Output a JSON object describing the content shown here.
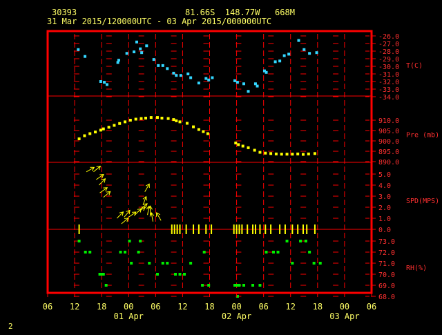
{
  "header": {
    "station": "30393",
    "location": "81.66S  148.77W   668M",
    "period": "31 Mar 2015/120000UTC - 03 Apr 2015/000000UTC"
  },
  "page_number": "2",
  "colors": {
    "background": "#000000",
    "frame": "#ff0000",
    "header_text": "#ffff66",
    "axis_text": "#ff3030",
    "time_labels": "#ffff66",
    "temperature": "#33d6ff",
    "pressure": "#ffff00",
    "wind": "#ffff00",
    "humidity": "#00ee00"
  },
  "chart_data": {
    "type": "scatter",
    "x_unit": "hours since 31 Mar 2015 06 UTC",
    "x_range": [
      0,
      72
    ],
    "x_ticks": [
      "06",
      "12",
      "18",
      "00",
      "06",
      "12",
      "18",
      "00",
      "06",
      "12",
      "18",
      "00",
      "06"
    ],
    "day_labels": [
      {
        "text": "01 Apr",
        "x": 18
      },
      {
        "text": "02 Apr",
        "x": 42
      },
      {
        "text": "03 Apr",
        "x": 66
      }
    ],
    "panels": [
      {
        "id": "temperature",
        "label": "T(C)",
        "ylim": [
          -34,
          -26
        ],
        "ticks": [
          "-26.0",
          "-27.0",
          "-28.0",
          "-29.0",
          "-30.0",
          "-31.0",
          "-32.0",
          "-33.0",
          "-34.0"
        ],
        "points": [
          [
            6.8,
            -27.8
          ],
          [
            8.3,
            -28.7
          ],
          [
            11.8,
            -32.0
          ],
          [
            12.6,
            -32.1
          ],
          [
            13.2,
            -32.4
          ],
          [
            15.6,
            -29.5
          ],
          [
            15.8,
            -29.2
          ],
          [
            17.6,
            -28.3
          ],
          [
            19.2,
            -28.1
          ],
          [
            19.8,
            -26.8
          ],
          [
            20.6,
            -27.7
          ],
          [
            20.9,
            -28.2
          ],
          [
            22.0,
            -27.3
          ],
          [
            23.6,
            -29.1
          ],
          [
            24.6,
            -29.9
          ],
          [
            25.6,
            -29.9
          ],
          [
            26.6,
            -30.3
          ],
          [
            28.0,
            -30.9
          ],
          [
            28.6,
            -31.2
          ],
          [
            29.6,
            -31.2
          ],
          [
            31.2,
            -31.0
          ],
          [
            31.8,
            -31.5
          ],
          [
            33.6,
            -32.2
          ],
          [
            35.2,
            -31.6
          ],
          [
            35.8,
            -31.8
          ],
          [
            36.6,
            -31.5
          ],
          [
            41.6,
            -31.9
          ],
          [
            42.2,
            -32.1
          ],
          [
            43.6,
            -32.3
          ],
          [
            44.6,
            -33.3
          ],
          [
            46.2,
            -32.3
          ],
          [
            46.6,
            -32.6
          ],
          [
            48.2,
            -30.6
          ],
          [
            48.6,
            -30.8
          ],
          [
            50.6,
            -29.4
          ],
          [
            51.6,
            -29.3
          ],
          [
            52.6,
            -28.6
          ],
          [
            53.6,
            -28.4
          ],
          [
            55.8,
            -26.6
          ],
          [
            57.0,
            -27.8
          ],
          [
            58.2,
            -28.3
          ],
          [
            59.8,
            -28.2
          ]
        ]
      },
      {
        "id": "pressure",
        "label": "Pre (mb)",
        "ylim": [
          890,
          915
        ],
        "ticks": [
          "910.0",
          "905.0",
          "900.0",
          "895.0",
          "890.0"
        ],
        "points": [
          [
            7.0,
            901.0
          ],
          [
            8.2,
            902.5
          ],
          [
            9.4,
            903.5
          ],
          [
            10.6,
            904.3
          ],
          [
            11.8,
            905.2
          ],
          [
            12.4,
            905.8
          ],
          [
            13.6,
            906.6
          ],
          [
            14.8,
            907.5
          ],
          [
            16.0,
            908.4
          ],
          [
            17.2,
            909.2
          ],
          [
            18.4,
            910.0
          ],
          [
            19.6,
            910.5
          ],
          [
            20.8,
            910.8
          ],
          [
            21.8,
            911.0
          ],
          [
            23.0,
            911.3
          ],
          [
            24.4,
            911.3
          ],
          [
            25.4,
            911.0
          ],
          [
            26.8,
            910.8
          ],
          [
            28.0,
            910.3
          ],
          [
            28.6,
            909.7
          ],
          [
            29.4,
            909.2
          ],
          [
            31.0,
            908.5
          ],
          [
            32.4,
            906.8
          ],
          [
            33.6,
            905.5
          ],
          [
            34.6,
            904.5
          ],
          [
            35.6,
            903.5
          ],
          [
            41.8,
            899.0
          ],
          [
            42.4,
            898.2
          ],
          [
            43.4,
            897.5
          ],
          [
            44.6,
            896.7
          ],
          [
            46.0,
            895.5
          ],
          [
            47.2,
            894.5
          ],
          [
            48.4,
            894.1
          ],
          [
            49.6,
            893.9
          ],
          [
            50.8,
            893.7
          ],
          [
            52.0,
            893.6
          ],
          [
            53.2,
            893.6
          ],
          [
            54.4,
            893.6
          ],
          [
            55.6,
            893.7
          ],
          [
            56.8,
            893.5
          ],
          [
            58.0,
            893.7
          ],
          [
            59.4,
            893.9
          ]
        ]
      },
      {
        "id": "wind",
        "label": "SPD(MPS)",
        "ylim": [
          0,
          5
        ],
        "ticks": [
          "5.0",
          "4.0",
          "3.0",
          "2.0",
          "1.0",
          "0.0"
        ],
        "arrows": [
          [
            8.6,
            5.2,
            30
          ],
          [
            10.2,
            5.2,
            40
          ],
          [
            10.8,
            4.5,
            35
          ],
          [
            11.4,
            4.0,
            45
          ],
          [
            11.6,
            3.3,
            35
          ],
          [
            12.4,
            2.9,
            40
          ],
          [
            15.4,
            1.0,
            45
          ],
          [
            16.4,
            0.5,
            40
          ],
          [
            17.0,
            1.1,
            50
          ],
          [
            18.0,
            1.1,
            35
          ],
          [
            19.4,
            1.3,
            45
          ],
          [
            20.0,
            1.6,
            30
          ],
          [
            20.6,
            1.8,
            40
          ],
          [
            21.2,
            2.2,
            70
          ],
          [
            21.6,
            3.4,
            60
          ],
          [
            22.2,
            1.3,
            80
          ],
          [
            22.8,
            1.3,
            90
          ],
          [
            23.4,
            0.7,
            100
          ],
          [
            25.2,
            0.8,
            120
          ]
        ],
        "calm_ticks": [
          7.0,
          27.6,
          28.2,
          28.8,
          29.4,
          30.8,
          32.4,
          33.6,
          35.2,
          36.4,
          41.4,
          42.0,
          42.6,
          43.2,
          44.4,
          45.6,
          46.2,
          47.2,
          48.4,
          49.6,
          51.6,
          52.8,
          54.4,
          55.6,
          56.8,
          57.6,
          59.4
        ]
      },
      {
        "id": "humidity",
        "label": "RH(%)",
        "ylim": [
          68,
          73
        ],
        "ticks": [
          "73.0",
          "72.0",
          "71.0",
          "70.0",
          "69.0",
          "68.0"
        ],
        "points": [
          [
            7.0,
            73.0
          ],
          [
            8.4,
            72.0
          ],
          [
            9.4,
            72.0
          ],
          [
            11.6,
            70.0
          ],
          [
            12.0,
            70.0
          ],
          [
            12.4,
            70.0
          ],
          [
            13.0,
            69.0
          ],
          [
            16.2,
            72.0
          ],
          [
            17.2,
            72.0
          ],
          [
            18.2,
            73.0
          ],
          [
            18.6,
            71.0
          ],
          [
            20.6,
            73.0
          ],
          [
            20.2,
            72.0
          ],
          [
            22.6,
            71.0
          ],
          [
            24.4,
            70.0
          ],
          [
            25.6,
            71.0
          ],
          [
            26.6,
            71.0
          ],
          [
            28.4,
            70.0
          ],
          [
            29.4,
            70.0
          ],
          [
            30.4,
            70.0
          ],
          [
            31.8,
            71.0
          ],
          [
            34.4,
            69.0
          ],
          [
            34.8,
            72.0
          ],
          [
            35.8,
            69.0
          ],
          [
            41.6,
            69.0
          ],
          [
            42.0,
            69.0
          ],
          [
            42.6,
            69.0
          ],
          [
            42.2,
            68.0
          ],
          [
            43.6,
            69.0
          ],
          [
            45.6,
            69.0
          ],
          [
            47.2,
            69.0
          ],
          [
            48.6,
            72.0
          ],
          [
            50.2,
            72.0
          ],
          [
            51.2,
            72.0
          ],
          [
            53.2,
            73.0
          ],
          [
            54.4,
            71.0
          ],
          [
            56.2,
            73.0
          ],
          [
            57.4,
            73.0
          ],
          [
            58.2,
            72.0
          ],
          [
            59.2,
            71.0
          ],
          [
            60.6,
            71.0
          ]
        ]
      }
    ]
  }
}
